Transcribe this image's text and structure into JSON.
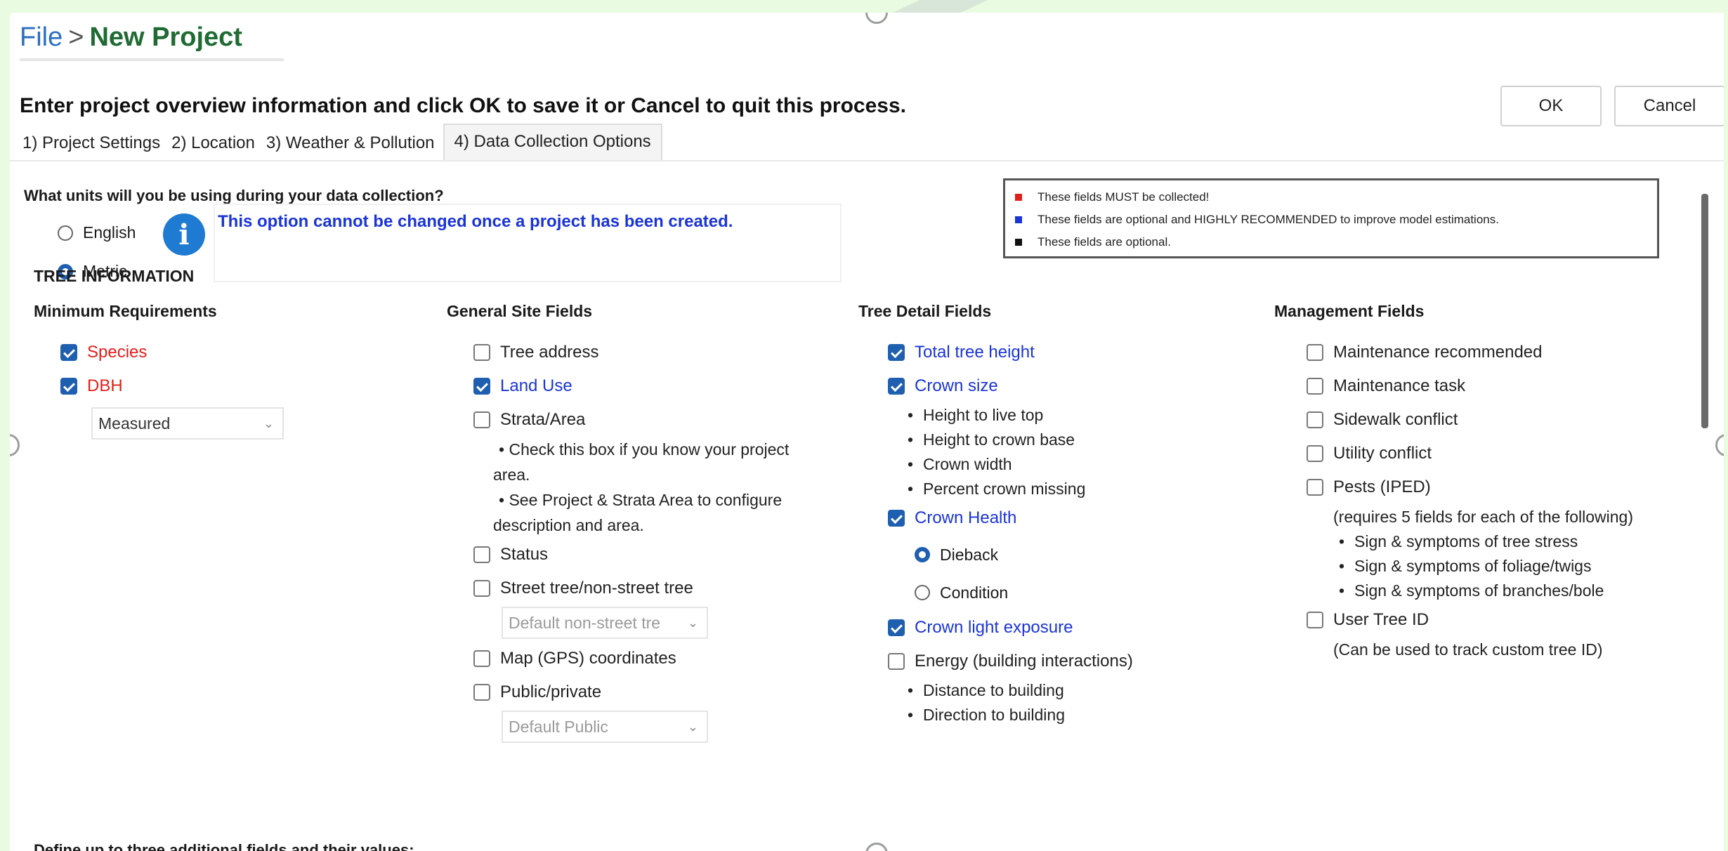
{
  "breadcrumb": {
    "file": "File",
    "separator": ">",
    "current": "New Project"
  },
  "instruction": "Enter project overview information and click OK to save it or Cancel to quit this process.",
  "buttons": {
    "ok": "OK",
    "cancel": "Cancel"
  },
  "tabs": [
    {
      "label": "1) Project Settings",
      "active": false
    },
    {
      "label": "2) Location",
      "active": false
    },
    {
      "label": "3) Weather & Pollution",
      "active": false
    },
    {
      "label": "4) Data Collection Options",
      "active": true
    }
  ],
  "units": {
    "question": "What units will you be using during your data collection?",
    "options": [
      {
        "label": "English",
        "selected": false
      },
      {
        "label": "Metric",
        "selected": true
      }
    ],
    "info_text": "This option cannot be changed once a project has been created."
  },
  "legend": [
    {
      "color": "#e0201c",
      "text": "These fields MUST be collected!"
    },
    {
      "color": "#1a34d6",
      "text": "These fields are optional and HIGHLY RECOMMENDED to improve model estimations."
    },
    {
      "color": "#111111",
      "text": "These fields are optional."
    }
  ],
  "tree_information": "TREE INFORMATION",
  "minimum_requirements": {
    "title": "Minimum Requirements",
    "species": "Species",
    "dbh": "DBH",
    "dbh_method": "Measured"
  },
  "general_site": {
    "title": "General Site Fields",
    "tree_address": "Tree address",
    "land_use": "Land Use",
    "strata_area": "Strata/Area",
    "strata_bullet_1": "Check this box if you know your project area.",
    "strata_bullet_2": "See Project & Strata Area to configure description and area.",
    "status": "Status",
    "street_tree": "Street tree/non-street tree",
    "street_default": "Default non-street tre",
    "map_coords": "Map (GPS) coordinates",
    "public_private": "Public/private",
    "public_default": "Default Public"
  },
  "tree_detail": {
    "title": "Tree Detail Fields",
    "total_height": "Total tree height",
    "crown_size": "Crown size",
    "crown_size_bullets": [
      "Height to live top",
      "Height to crown base",
      "Crown width",
      "Percent crown missing"
    ],
    "crown_health": "Crown Health",
    "dieback": "Dieback",
    "condition": "Condition",
    "crown_light": "Crown light exposure",
    "energy": "Energy (building interactions)",
    "energy_bullets": [
      "Distance to building",
      "Direction to building"
    ]
  },
  "management": {
    "title": "Management Fields",
    "maint_recommended": "Maintenance recommended",
    "maint_task": "Maintenance task",
    "sidewalk": "Sidewalk conflict",
    "utility": "Utility conflict",
    "pests": "Pests (IPED)",
    "pests_note": "(requires 5 fields for each of the following)",
    "pests_bullets": [
      "Sign & symptoms of tree stress",
      "Sign & symptoms of foliage/twigs",
      "Sign & symptoms of branches/bole"
    ],
    "user_tree_id": "User Tree ID",
    "user_tree_note": "(Can be used to track custom tree ID)"
  },
  "additional_fields": "Define up to three additional fields and their values:",
  "icons": [
    "info-icon",
    "chevron-down-icon",
    "checkbox-icon",
    "radio-icon"
  ]
}
